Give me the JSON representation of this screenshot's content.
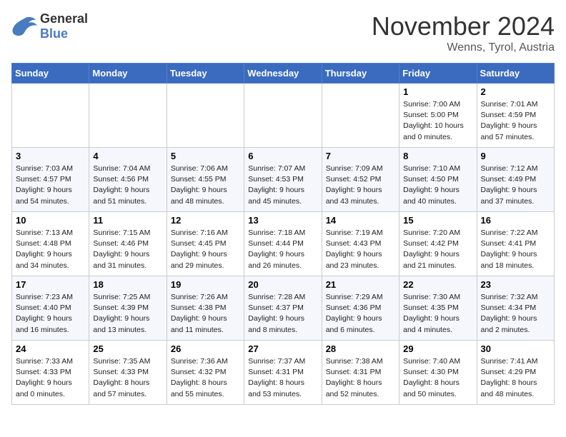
{
  "header": {
    "logo_general": "General",
    "logo_blue": "Blue",
    "month_title": "November 2024",
    "location": "Wenns, Tyrol, Austria"
  },
  "days_of_week": [
    "Sunday",
    "Monday",
    "Tuesday",
    "Wednesday",
    "Thursday",
    "Friday",
    "Saturday"
  ],
  "weeks": [
    [
      {
        "day": "",
        "info": ""
      },
      {
        "day": "",
        "info": ""
      },
      {
        "day": "",
        "info": ""
      },
      {
        "day": "",
        "info": ""
      },
      {
        "day": "",
        "info": ""
      },
      {
        "day": "1",
        "info": "Sunrise: 7:00 AM\nSunset: 5:00 PM\nDaylight: 10 hours\nand 0 minutes."
      },
      {
        "day": "2",
        "info": "Sunrise: 7:01 AM\nSunset: 4:59 PM\nDaylight: 9 hours\nand 57 minutes."
      }
    ],
    [
      {
        "day": "3",
        "info": "Sunrise: 7:03 AM\nSunset: 4:57 PM\nDaylight: 9 hours\nand 54 minutes."
      },
      {
        "day": "4",
        "info": "Sunrise: 7:04 AM\nSunset: 4:56 PM\nDaylight: 9 hours\nand 51 minutes."
      },
      {
        "day": "5",
        "info": "Sunrise: 7:06 AM\nSunset: 4:55 PM\nDaylight: 9 hours\nand 48 minutes."
      },
      {
        "day": "6",
        "info": "Sunrise: 7:07 AM\nSunset: 4:53 PM\nDaylight: 9 hours\nand 45 minutes."
      },
      {
        "day": "7",
        "info": "Sunrise: 7:09 AM\nSunset: 4:52 PM\nDaylight: 9 hours\nand 43 minutes."
      },
      {
        "day": "8",
        "info": "Sunrise: 7:10 AM\nSunset: 4:50 PM\nDaylight: 9 hours\nand 40 minutes."
      },
      {
        "day": "9",
        "info": "Sunrise: 7:12 AM\nSunset: 4:49 PM\nDaylight: 9 hours\nand 37 minutes."
      }
    ],
    [
      {
        "day": "10",
        "info": "Sunrise: 7:13 AM\nSunset: 4:48 PM\nDaylight: 9 hours\nand 34 minutes."
      },
      {
        "day": "11",
        "info": "Sunrise: 7:15 AM\nSunset: 4:46 PM\nDaylight: 9 hours\nand 31 minutes."
      },
      {
        "day": "12",
        "info": "Sunrise: 7:16 AM\nSunset: 4:45 PM\nDaylight: 9 hours\nand 29 minutes."
      },
      {
        "day": "13",
        "info": "Sunrise: 7:18 AM\nSunset: 4:44 PM\nDaylight: 9 hours\nand 26 minutes."
      },
      {
        "day": "14",
        "info": "Sunrise: 7:19 AM\nSunset: 4:43 PM\nDaylight: 9 hours\nand 23 minutes."
      },
      {
        "day": "15",
        "info": "Sunrise: 7:20 AM\nSunset: 4:42 PM\nDaylight: 9 hours\nand 21 minutes."
      },
      {
        "day": "16",
        "info": "Sunrise: 7:22 AM\nSunset: 4:41 PM\nDaylight: 9 hours\nand 18 minutes."
      }
    ],
    [
      {
        "day": "17",
        "info": "Sunrise: 7:23 AM\nSunset: 4:40 PM\nDaylight: 9 hours\nand 16 minutes."
      },
      {
        "day": "18",
        "info": "Sunrise: 7:25 AM\nSunset: 4:39 PM\nDaylight: 9 hours\nand 13 minutes."
      },
      {
        "day": "19",
        "info": "Sunrise: 7:26 AM\nSunset: 4:38 PM\nDaylight: 9 hours\nand 11 minutes."
      },
      {
        "day": "20",
        "info": "Sunrise: 7:28 AM\nSunset: 4:37 PM\nDaylight: 9 hours\nand 8 minutes."
      },
      {
        "day": "21",
        "info": "Sunrise: 7:29 AM\nSunset: 4:36 PM\nDaylight: 9 hours\nand 6 minutes."
      },
      {
        "day": "22",
        "info": "Sunrise: 7:30 AM\nSunset: 4:35 PM\nDaylight: 9 hours\nand 4 minutes."
      },
      {
        "day": "23",
        "info": "Sunrise: 7:32 AM\nSunset: 4:34 PM\nDaylight: 9 hours\nand 2 minutes."
      }
    ],
    [
      {
        "day": "24",
        "info": "Sunrise: 7:33 AM\nSunset: 4:33 PM\nDaylight: 9 hours\nand 0 minutes."
      },
      {
        "day": "25",
        "info": "Sunrise: 7:35 AM\nSunset: 4:33 PM\nDaylight: 8 hours\nand 57 minutes."
      },
      {
        "day": "26",
        "info": "Sunrise: 7:36 AM\nSunset: 4:32 PM\nDaylight: 8 hours\nand 55 minutes."
      },
      {
        "day": "27",
        "info": "Sunrise: 7:37 AM\nSunset: 4:31 PM\nDaylight: 8 hours\nand 53 minutes."
      },
      {
        "day": "28",
        "info": "Sunrise: 7:38 AM\nSunset: 4:31 PM\nDaylight: 8 hours\nand 52 minutes."
      },
      {
        "day": "29",
        "info": "Sunrise: 7:40 AM\nSunset: 4:30 PM\nDaylight: 8 hours\nand 50 minutes."
      },
      {
        "day": "30",
        "info": "Sunrise: 7:41 AM\nSunset: 4:29 PM\nDaylight: 8 hours\nand 48 minutes."
      }
    ]
  ]
}
